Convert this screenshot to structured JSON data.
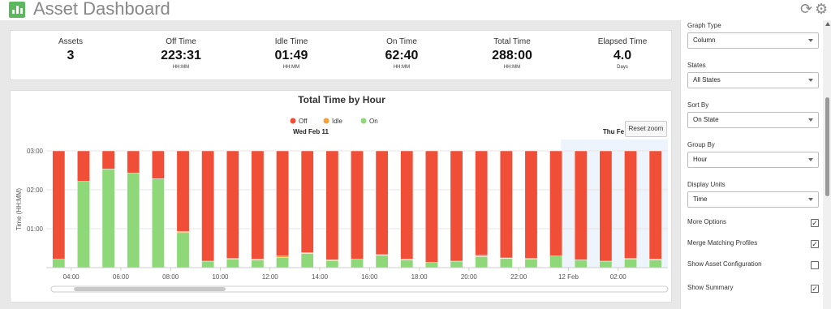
{
  "header": {
    "title": "Asset Dashboard",
    "icon": "bar-chart-icon",
    "refresh_icon": "refresh-icon",
    "settings_icon": "gear-icon"
  },
  "summary": [
    {
      "label": "Assets",
      "value": "3",
      "unit": ""
    },
    {
      "label": "Off Time",
      "value": "223:31",
      "unit": "HH:MM"
    },
    {
      "label": "Idle Time",
      "value": "01:49",
      "unit": "HH:MM"
    },
    {
      "label": "On Time",
      "value": "62:40",
      "unit": "HH:MM"
    },
    {
      "label": "Total Time",
      "value": "288:00",
      "unit": "HH:MM"
    },
    {
      "label": "Elapsed Time",
      "value": "4.0",
      "unit": "Days"
    }
  ],
  "reset_zoom_label": "Reset zoom",
  "chart_data": {
    "type": "bar",
    "stacked": true,
    "title": "Total Time by Hour",
    "ylabel": "Time (HH:MM)",
    "ylim_minutes": [
      0,
      180
    ],
    "yticks": [
      "01:00",
      "02:00",
      "03:00"
    ],
    "xticks": [
      "04:00",
      "06:00",
      "08:00",
      "10:00",
      "12:00",
      "14:00",
      "16:00",
      "18:00",
      "20:00",
      "22:00",
      "12 Feb",
      "02:00"
    ],
    "date_labels": [
      "Wed Feb 11",
      "Thu Fe"
    ],
    "colors": {
      "Off": "#f04e37",
      "Idle": "#f7a035",
      "On": "#8ed87a"
    },
    "series": [
      {
        "name": "Off",
        "values": [
          167,
          47,
          28,
          34,
          43,
          124,
          170,
          166,
          167,
          162,
          157,
          168,
          167,
          160,
          167,
          172,
          170,
          161,
          165,
          166,
          162,
          168,
          170,
          166,
          167
        ]
      },
      {
        "name": "Idle",
        "values": [
          0,
          0,
          0,
          0,
          0,
          2,
          0,
          1,
          1,
          2,
          1,
          1,
          0,
          1,
          1,
          0,
          0,
          2,
          1,
          1,
          0,
          0,
          0,
          1,
          1
        ]
      },
      {
        "name": "On",
        "values": [
          13,
          133,
          152,
          146,
          137,
          54,
          10,
          13,
          12,
          16,
          22,
          11,
          13,
          19,
          12,
          8,
          10,
          17,
          14,
          13,
          18,
          12,
          10,
          13,
          12
        ]
      }
    ],
    "highlight_range_start_index": 21
  },
  "panel": {
    "fields": [
      {
        "label": "Graph Type",
        "value": "Column"
      },
      {
        "label": "States",
        "value": "All States"
      },
      {
        "label": "Sort By",
        "value": "On State"
      },
      {
        "label": "Group By",
        "value": "Hour"
      },
      {
        "label": "Display Units",
        "value": "Time"
      }
    ],
    "checks": [
      {
        "label": "More Options",
        "checked": true
      },
      {
        "label": "Merge Matching Profiles",
        "checked": true
      },
      {
        "label": "Show Asset Configuration",
        "checked": false
      },
      {
        "label": "Show Summary",
        "checked": true
      }
    ]
  }
}
